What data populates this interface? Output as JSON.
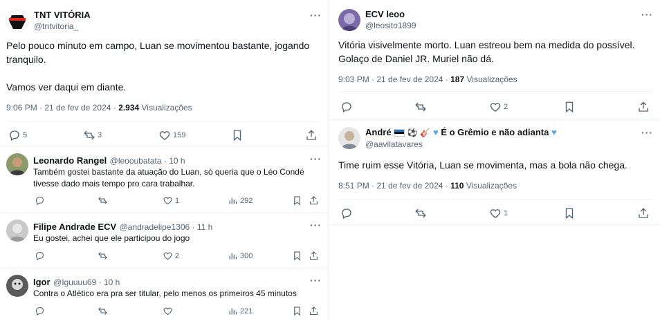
{
  "left": {
    "main_post": {
      "author_name": "TNT VITÓRIA",
      "author_handle": "@tntvitoria_",
      "text_line1": "Pelo pouco minuto em campo, Luan se movimentou bastante, jogando",
      "text_line2": "tranquilo.",
      "text_line3": "Vamos ver daqui em diante.",
      "time": "9:06 PM · 21 de fev de 2024 ·",
      "views_count": "2.934",
      "views_label": "Visualizações",
      "replies": "5",
      "reposts": "3",
      "likes": "159"
    },
    "replies": [
      {
        "name": "Leonardo Rangel",
        "handle": "@leooubatata · 10 h",
        "text_line1": "Também gostei bastante da atuação do Luan, só queria que o Léo Condé",
        "text_line2": "tivesse dado mais tempo pro cara trabalhar.",
        "likes": "1",
        "views": "292"
      },
      {
        "name": "Filipe Andrade ECV",
        "handle": "@andradelipe1306 · 11 h",
        "text_line1": "Eu gostei, achei que ele participou do jogo",
        "likes": "2",
        "views": "300"
      },
      {
        "name": "Igor",
        "handle": "@Iguuuu69 · 10 h",
        "text_line1": "Contra o Atlético era pra ser titular, pelo menos os primeiros 45 minutos",
        "views": "221"
      }
    ]
  },
  "right": {
    "post1": {
      "author_name": "ECV leoo",
      "author_handle": "@leosito1899",
      "text_line1": "Vitória visivelmente morto. Luan estreou bem na medida do possível.",
      "text_line2": "Golaço de Daniel JR. Muriel não dá.",
      "time": "9:03 PM · 21 de fev de 2024 ·",
      "views_count": "187",
      "views_label": "Visualizações",
      "likes": "2"
    },
    "post2": {
      "author_name": "André",
      "author_name_suffix": "É o Grêmio e não adianta",
      "author_handle": "@aavilatavares",
      "text_line1": "Time ruim esse Vitória, Luan se movimenta, mas a bola não chega.",
      "time": "8:51 PM · 21 de fev de 2024 ·",
      "views_count": "110",
      "views_label": "Visualizações",
      "likes": "1"
    }
  },
  "icons": [
    "more-icon",
    "reply-icon",
    "repost-icon",
    "like-icon",
    "bookmark-icon",
    "share-icon",
    "views-icon"
  ],
  "colors": {
    "text": "#0f1419",
    "secondary": "#536471",
    "divider": "#eff3f4",
    "brand_red": "#e2231a"
  }
}
